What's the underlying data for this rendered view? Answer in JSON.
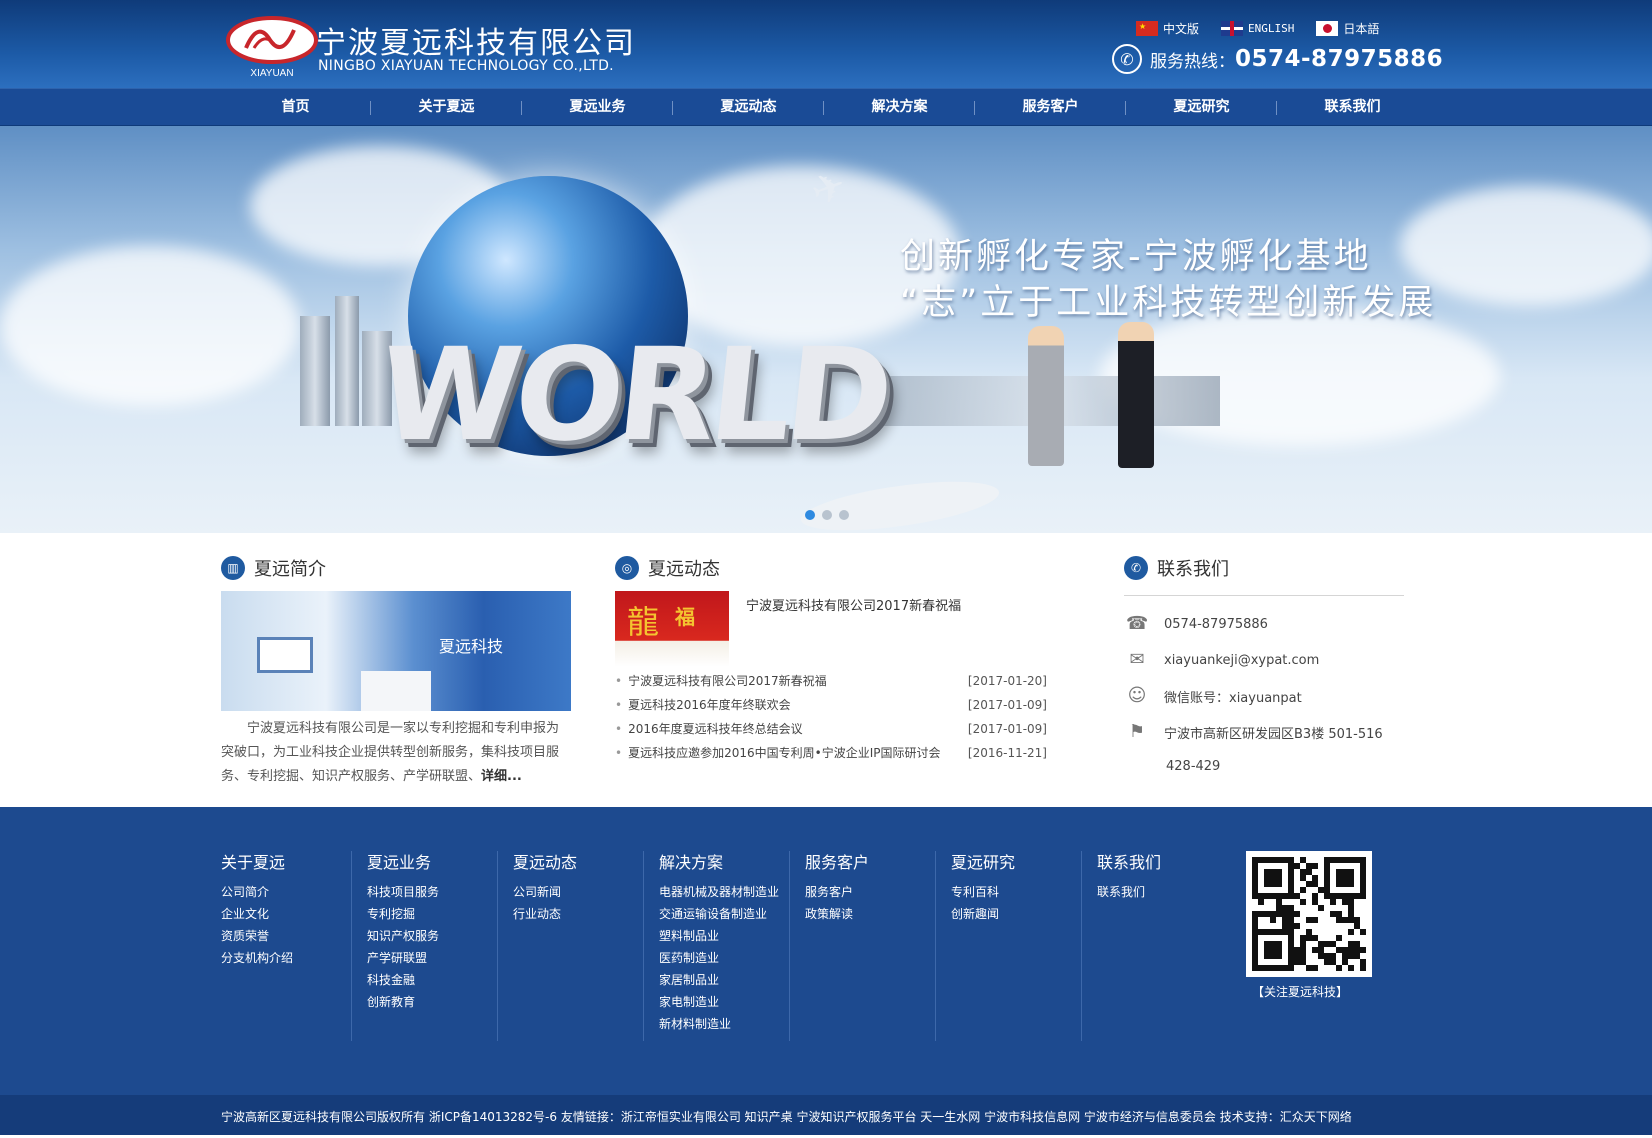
{
  "header": {
    "logo_text": "XIAYUAN",
    "company_cn": "宁波夏远科技有限公司",
    "company_en": "NINGBO XIAYUAN TECHNOLOGY CO.,LTD.",
    "languages": [
      {
        "label": "中文版",
        "flag": "china-flag-icon"
      },
      {
        "label": "ENGLISH",
        "flag": "uk-flag-icon"
      },
      {
        "label": "日本語",
        "flag": "japan-flag-icon"
      }
    ],
    "hotline_label": "服务热线：",
    "hotline_number": "0574-87975886"
  },
  "nav": [
    "首页",
    "关于夏远",
    "夏远业务",
    "夏远动态",
    "解决方案",
    "服务客户",
    "夏远研究",
    "联系我们"
  ],
  "banner": {
    "slogan_line1": "创新孵化专家-宁波孵化基地",
    "slogan_line2": "“志”立于工业科技转型创新发展",
    "graphic_text": "WORLD",
    "slide_count": 3,
    "active_slide": 1
  },
  "about": {
    "title": "夏远简介",
    "image_wall_text": "夏远科技",
    "text": "宁波夏远科技有限公司是一家以专利挖掘和专利申报为突破口，为工业科技企业提供转型创新服务，集科技项目服务、专利挖掘、知识产权服务、产学研联盟、",
    "more": "详细..."
  },
  "news": {
    "title": "夏远动态",
    "headline": "宁波夏远科技有限公司2017新春祝福",
    "items": [
      {
        "title": "宁波夏远科技有限公司2017新春祝福",
        "date": "[2017-01-20]"
      },
      {
        "title": "夏远科技2016年度年终联欢会",
        "date": "[2017-01-09]"
      },
      {
        "title": "2016年度夏远科技年终总结会议",
        "date": "[2017-01-09]"
      },
      {
        "title": "夏远科技应邀参加2016中国专利周•宁波企业IP国际研讨会",
        "date": "[2016-11-21]"
      }
    ]
  },
  "contact": {
    "title": "联系我们",
    "phone": "0574-87975886",
    "email": "xiayuankeji@xypat.com",
    "wechat": "微信账号：xiayuanpat",
    "address_line1": "宁波市高新区研发园区B3楼 501-516",
    "address_line2": "428-429"
  },
  "footer": {
    "columns": [
      {
        "title": "关于夏远",
        "links": [
          "公司简介",
          "企业文化",
          "资质荣誉",
          "分支机构介绍"
        ]
      },
      {
        "title": "夏远业务",
        "links": [
          "科技项目服务",
          "专利挖掘",
          "知识产权服务",
          "产学研联盟",
          "科技金融",
          "创新教育"
        ]
      },
      {
        "title": "夏远动态",
        "links": [
          "公司新闻",
          "行业动态"
        ]
      },
      {
        "title": "解决方案",
        "links": [
          "电器机械及器材制造业",
          "交通运输设备制造业",
          "塑料制品业",
          "医药制造业",
          "家居制品业",
          "家电制造业",
          "新材料制造业"
        ]
      },
      {
        "title": "服务客户",
        "links": [
          "服务客户",
          "政策解读"
        ]
      },
      {
        "title": "夏远研究",
        "links": [
          "专利百科",
          "创新趣闻"
        ]
      },
      {
        "title": "联系我们",
        "links": [
          "联系我们"
        ]
      }
    ],
    "qr_caption": "【关注夏远科技】",
    "copyright": "宁波高新区夏远科技有限公司版权所有   浙ICP备14013282号-6   友情链接：浙江帝恒实业有限公司   知识产桌   宁波知识产权服务平台   天一生水网   宁波市科技信息网   宁波市经济与信息委员会  技术支持：汇众天下网络"
  },
  "colors": {
    "header_bg": "#1c5aa6",
    "nav_bg": "#1a4b96",
    "footer_bg": "#1d4a8f",
    "accent": "#1f5aa0",
    "active_dot": "#2e8ae0"
  }
}
